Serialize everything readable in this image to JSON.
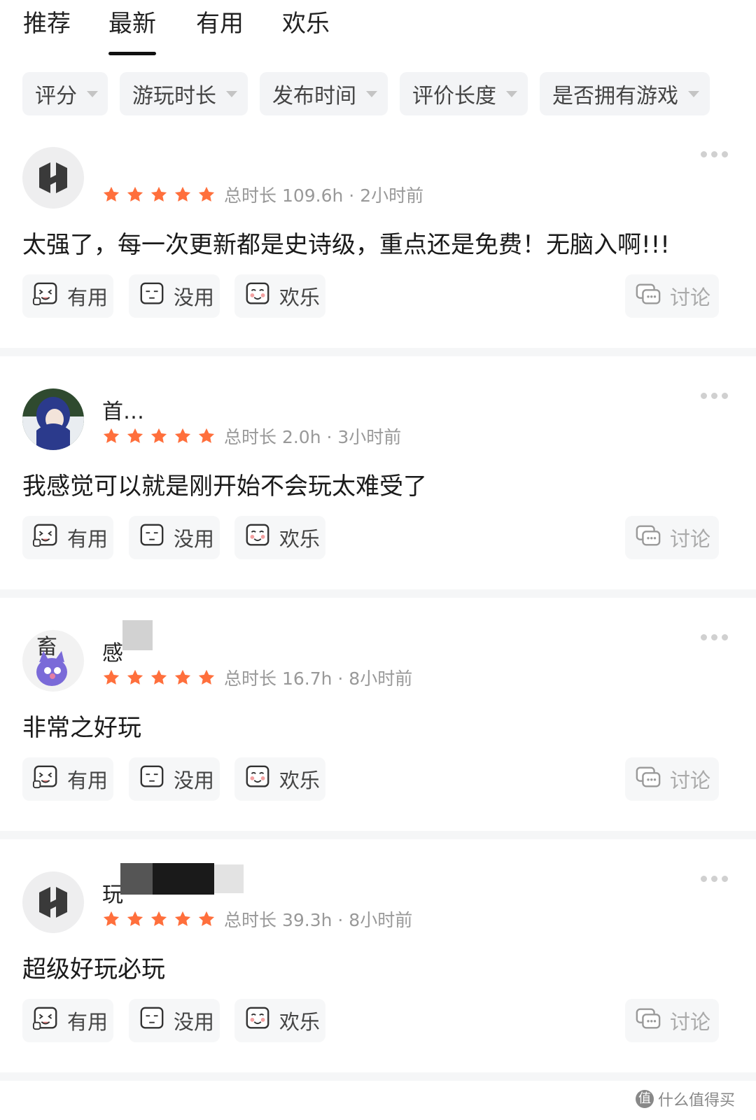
{
  "tabs": [
    "推荐",
    "最新",
    "有用",
    "欢乐"
  ],
  "active_tab": "最新",
  "filters": [
    "评分",
    "游玩时长",
    "发布时间",
    "评价长度",
    "是否拥有游戏"
  ],
  "reviews": [
    {
      "username": "",
      "rating": 5,
      "meta": "总时长 109.6h · 2小时前",
      "content": "太强了，每一次更新都是史诗级，重点还是免费！无脑入啊!!!",
      "avatar": "default-logo"
    },
    {
      "username": "首…",
      "rating": 5,
      "meta": "总时长 2.0h · 3小时前",
      "content": "我感觉可以就是刚开始不会玩太难受了",
      "avatar": "anime-girl"
    },
    {
      "username": "感",
      "rating": 5,
      "meta": "总时长 16.7h · 8小时前",
      "content": "非常之好玩",
      "avatar": "cat-character"
    },
    {
      "username": "玩",
      "rating": 5,
      "meta": "总时长 39.3h · 8小时前",
      "content": "超级好玩必玩",
      "avatar": "default-logo"
    }
  ],
  "actions": {
    "useful": "有用",
    "useless": "没用",
    "funny": "欢乐",
    "discuss": "讨论"
  },
  "colors": {
    "star": "#ff6f3c",
    "accent": "#111111",
    "muted": "#999999"
  },
  "watermark": "什么值得买"
}
